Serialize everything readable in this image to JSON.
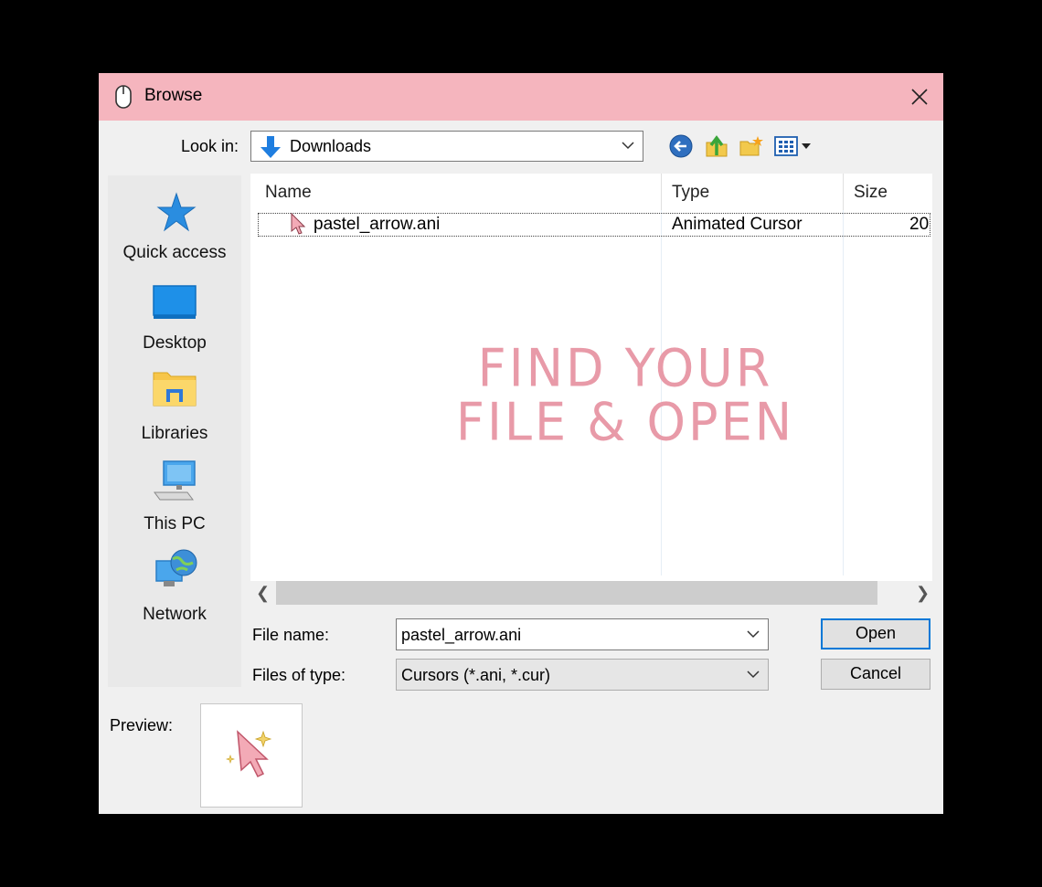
{
  "window": {
    "title": "Browse"
  },
  "toolbar": {
    "look_in_label": "Look in:",
    "look_in_value": "Downloads"
  },
  "places": [
    {
      "label": "Quick access",
      "icon": "star-icon"
    },
    {
      "label": "Desktop",
      "icon": "desktop-icon"
    },
    {
      "label": "Libraries",
      "icon": "libraries-icon"
    },
    {
      "label": "This PC",
      "icon": "computer-icon"
    },
    {
      "label": "Network",
      "icon": "network-icon"
    }
  ],
  "file_list": {
    "columns": [
      "Name",
      "Type",
      "Size"
    ],
    "rows": [
      {
        "name": "pastel_arrow.ani",
        "type": "Animated Cursor",
        "size": "20"
      }
    ]
  },
  "overlay_text": [
    "FIND YOUR",
    "FILE & OPEN"
  ],
  "form": {
    "file_name_label": "File name:",
    "file_name_value": "pastel_arrow.ani",
    "file_type_label": "Files of type:",
    "file_type_value": "Cursors (*.ani, *.cur)"
  },
  "buttons": {
    "open": "Open",
    "cancel": "Cancel"
  },
  "preview_label": "Preview:",
  "colors": {
    "titlebar": "#f5b5be",
    "accent_pink": "#e89aa8",
    "focus_blue": "#0078d7"
  }
}
